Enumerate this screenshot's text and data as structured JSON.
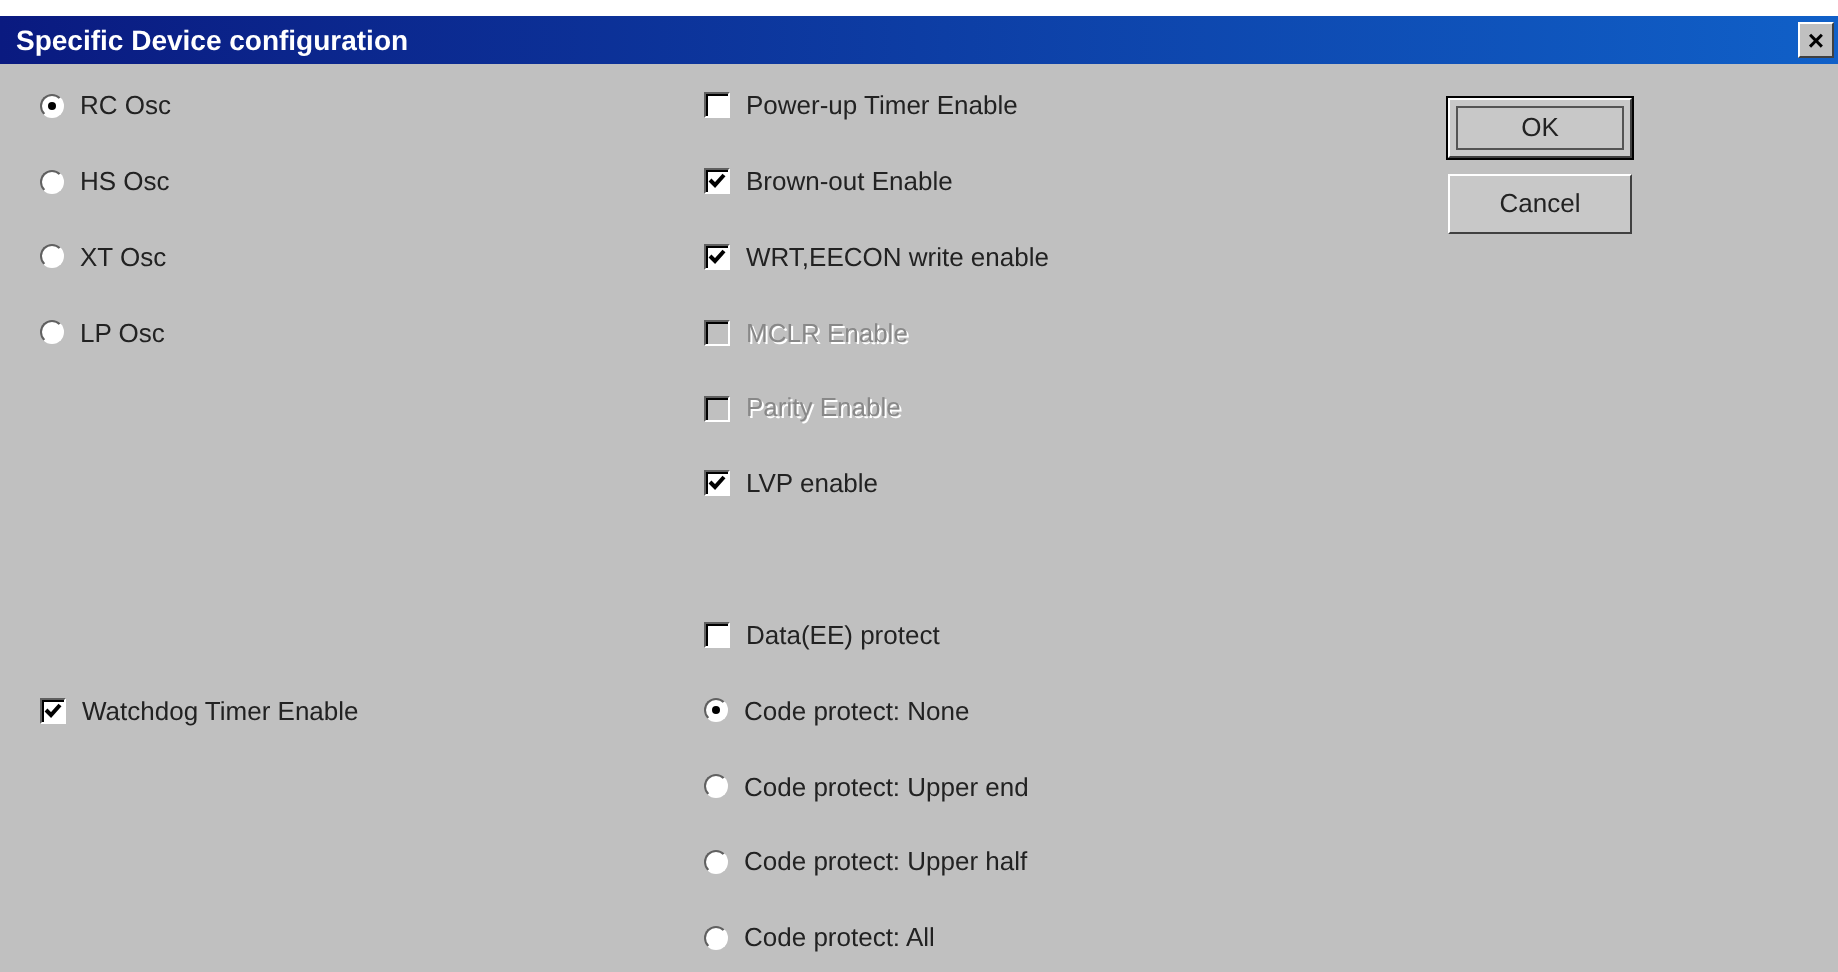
{
  "window": {
    "title": "Specific Device configuration",
    "close": "×"
  },
  "oscillator": [
    {
      "label": "RC Osc",
      "selected": true
    },
    {
      "label": "HS Osc",
      "selected": false
    },
    {
      "label": "XT Osc",
      "selected": false
    },
    {
      "label": "LP Osc",
      "selected": false
    }
  ],
  "watchdog": {
    "label": "Watchdog Timer Enable",
    "checked": true
  },
  "options": [
    {
      "label": "Power-up Timer Enable",
      "checked": false,
      "disabled": false
    },
    {
      "label": "Brown-out Enable",
      "checked": true,
      "disabled": false
    },
    {
      "label": "WRT,EECON write enable",
      "checked": true,
      "disabled": false
    },
    {
      "label": "MCLR Enable",
      "checked": false,
      "disabled": true
    },
    {
      "label": "Parity Enable",
      "checked": false,
      "disabled": true
    },
    {
      "label": "LVP enable",
      "checked": true,
      "disabled": false
    }
  ],
  "protection": [
    {
      "kind": "checkbox",
      "label": "Data(EE) protect",
      "checked": false
    },
    {
      "kind": "radio",
      "label": "Code protect: None",
      "selected": true
    },
    {
      "kind": "radio",
      "label": "Code protect: Upper end",
      "selected": false
    },
    {
      "kind": "radio",
      "label": "Code protect: Upper half",
      "selected": false
    },
    {
      "kind": "radio",
      "label": "Code protect: All",
      "selected": false
    }
  ],
  "buttons": [
    {
      "label": "OK",
      "focused": true
    },
    {
      "label": "Cancel",
      "focused": false
    }
  ]
}
